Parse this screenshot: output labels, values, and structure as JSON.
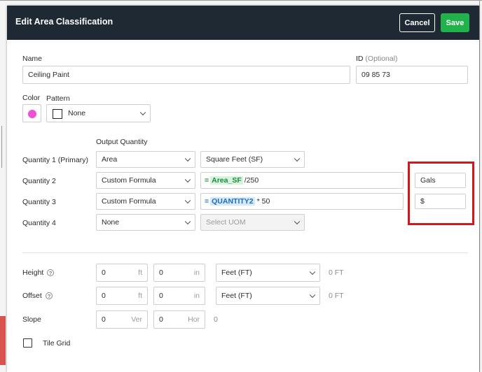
{
  "header": {
    "title": "Edit Area Classification",
    "cancel_label": "Cancel",
    "save_label": "Save"
  },
  "name": {
    "label": "Name",
    "value": "Ceiling Paint"
  },
  "id_field": {
    "label": "ID",
    "optional": "(Optional)",
    "value": "09 85 73"
  },
  "color": {
    "label": "Color",
    "value": "#f14fd4"
  },
  "pattern": {
    "label": "Pattern",
    "value": "None"
  },
  "output_quantity_header": "Output Quantity",
  "quantities": [
    {
      "label": "Quantity 1 (Primary)",
      "type": "Area",
      "uom": "Square Feet (SF)"
    },
    {
      "label": "Quantity 2",
      "type": "Custom Formula",
      "formula_eq": "=",
      "formula_token": "Area_SF",
      "formula_rest": "/250",
      "unit": "Gals"
    },
    {
      "label": "Quantity 3",
      "type": "Custom Formula",
      "formula_eq": "=",
      "formula_token": "QUANTITY2",
      "formula_rest": "* 50",
      "unit": "$"
    },
    {
      "label": "Quantity 4",
      "type": "None",
      "uom_placeholder": "Select UOM"
    }
  ],
  "height": {
    "label": "Height",
    "ft_value": "0",
    "ft_unit": "ft",
    "in_value": "0",
    "in_unit": "in",
    "units": "Feet (FT)",
    "readout": "0 FT"
  },
  "offset": {
    "label": "Offset",
    "ft_value": "0",
    "ft_unit": "ft",
    "in_value": "0",
    "in_unit": "in",
    "units": "Feet (FT)",
    "readout": "0 FT"
  },
  "slope": {
    "label": "Slope",
    "ver_value": "0",
    "ver_unit": "Ver",
    "hor_value": "0",
    "hor_unit": "Hor",
    "readout": "0"
  },
  "tile_grid": {
    "label": "Tile Grid",
    "checked": false
  },
  "help_glyph": "?",
  "colors": {
    "header": "#1e2933",
    "save": "#21b24b",
    "highlight": "#d0191e"
  }
}
